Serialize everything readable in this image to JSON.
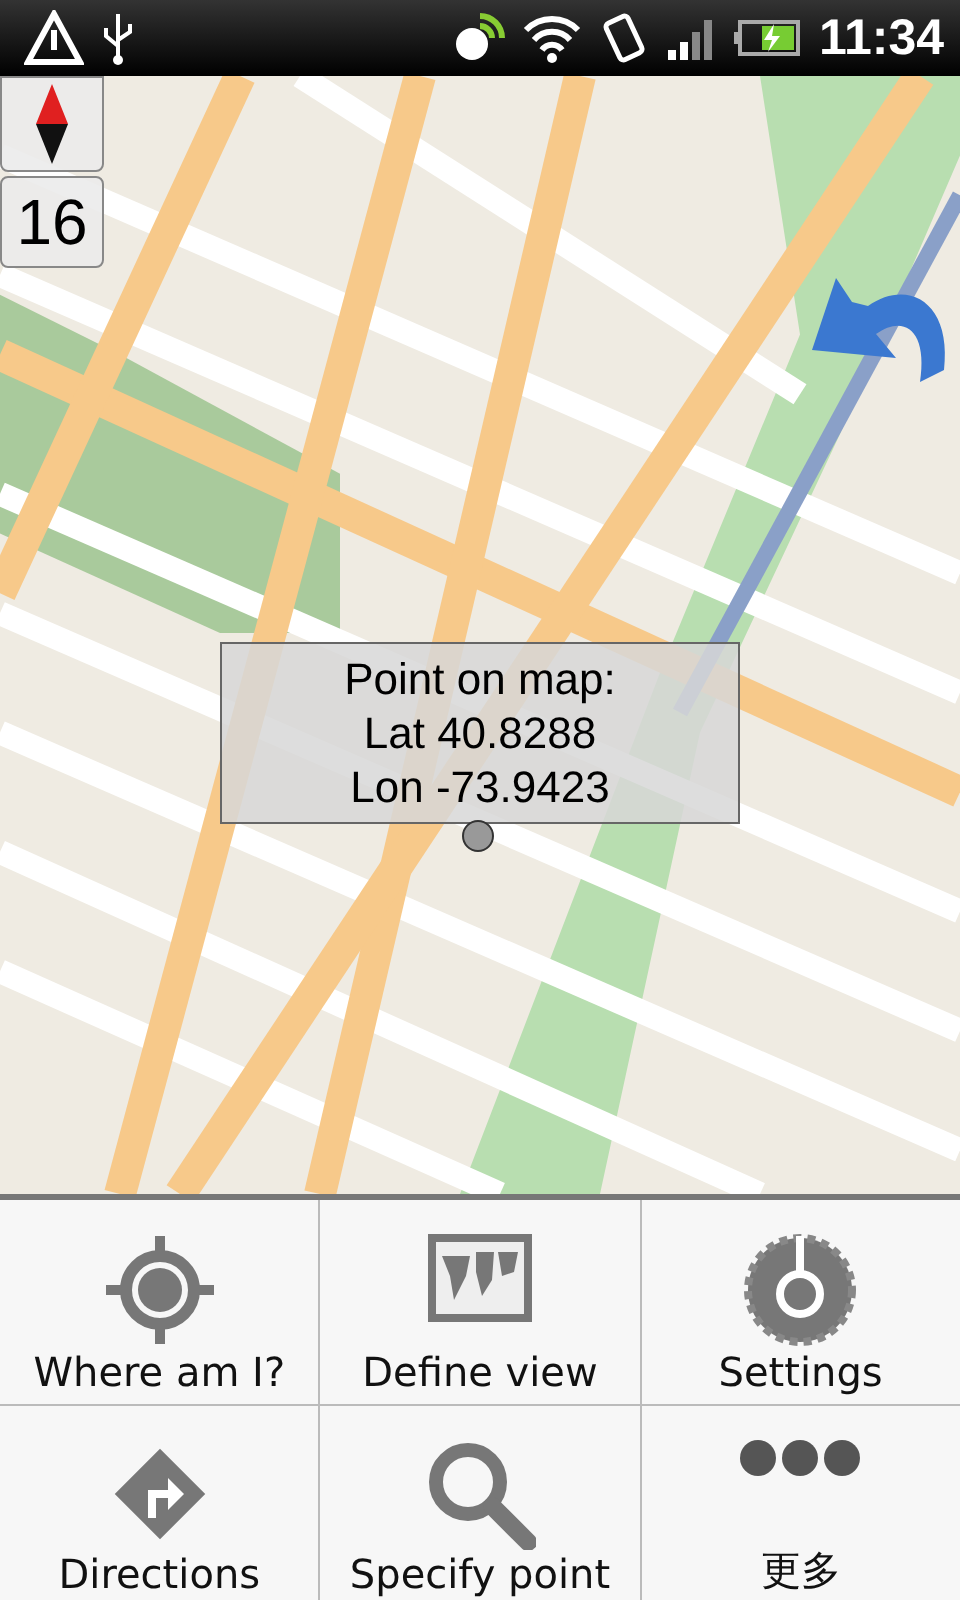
{
  "status_bar": {
    "time": "11:34"
  },
  "map": {
    "zoom_level": "16",
    "popup": {
      "title": "Point on map:",
      "lines": [
        "Lat 40.8288",
        "Lon -73.9423"
      ]
    }
  },
  "menu": [
    {
      "kind": "target",
      "label": "Where am I?"
    },
    {
      "kind": "map",
      "label": "Define view"
    },
    {
      "kind": "gear",
      "label": "Settings"
    },
    {
      "kind": "turn",
      "label": "Directions"
    },
    {
      "kind": "search",
      "label": "Specify point"
    },
    {
      "kind": "more",
      "label": "更多"
    }
  ]
}
